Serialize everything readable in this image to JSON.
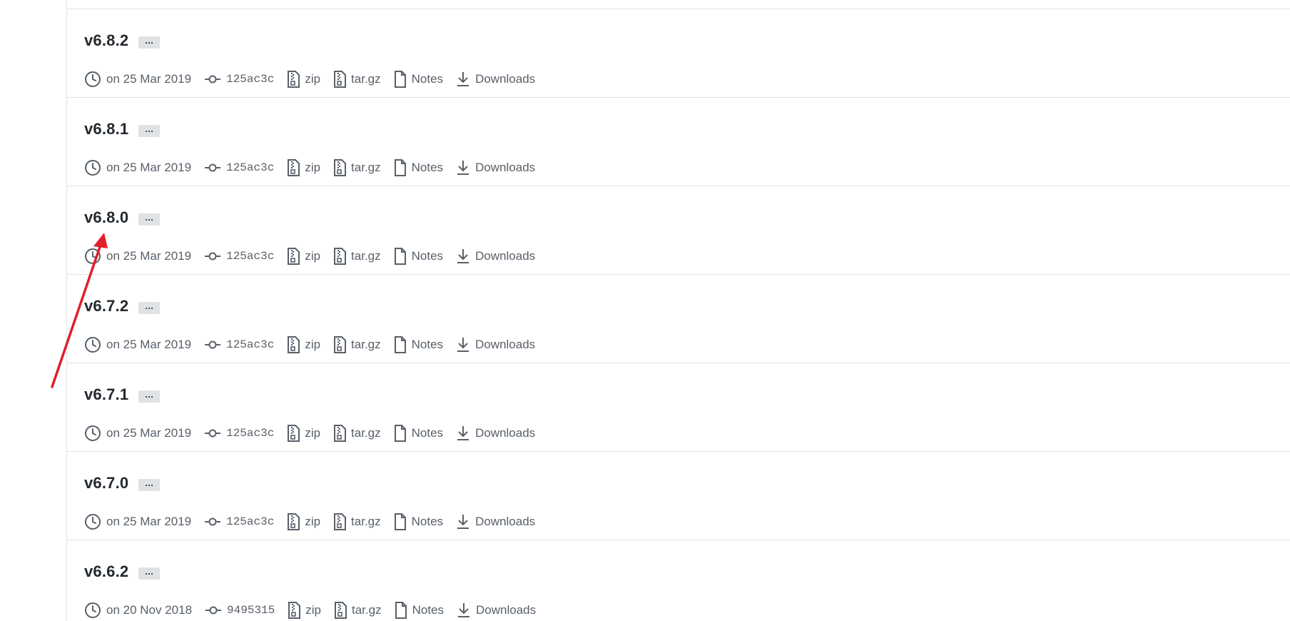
{
  "tags": [
    {
      "name": "v6.8.2",
      "date": "on 25 Mar 2019",
      "commit": "125ac3c",
      "zip": "zip",
      "targz": "tar.gz",
      "notes": "Notes",
      "downloads": "Downloads"
    },
    {
      "name": "v6.8.1",
      "date": "on 25 Mar 2019",
      "commit": "125ac3c",
      "zip": "zip",
      "targz": "tar.gz",
      "notes": "Notes",
      "downloads": "Downloads"
    },
    {
      "name": "v6.8.0",
      "date": "on 25 Mar 2019",
      "commit": "125ac3c",
      "zip": "zip",
      "targz": "tar.gz",
      "notes": "Notes",
      "downloads": "Downloads"
    },
    {
      "name": "v6.7.2",
      "date": "on 25 Mar 2019",
      "commit": "125ac3c",
      "zip": "zip",
      "targz": "tar.gz",
      "notes": "Notes",
      "downloads": "Downloads"
    },
    {
      "name": "v6.7.1",
      "date": "on 25 Mar 2019",
      "commit": "125ac3c",
      "zip": "zip",
      "targz": "tar.gz",
      "notes": "Notes",
      "downloads": "Downloads"
    },
    {
      "name": "v6.7.0",
      "date": "on 25 Mar 2019",
      "commit": "125ac3c",
      "zip": "zip",
      "targz": "tar.gz",
      "notes": "Notes",
      "downloads": "Downloads"
    },
    {
      "name": "v6.6.2",
      "date": "on 20 Nov 2018",
      "commit": "9495315",
      "zip": "zip",
      "targz": "tar.gz",
      "notes": "Notes",
      "downloads": "Downloads"
    }
  ],
  "icons": {
    "date": "clock-icon",
    "commit": "git-commit-icon",
    "zip": "file-zip-icon",
    "targz": "file-zip-icon",
    "notes": "file-icon",
    "downloads": "download-icon"
  },
  "colors": {
    "annotation_arrow": "#e0202a",
    "border": "#e1e4e8",
    "meta_text": "#586069",
    "title_text": "#24292e"
  }
}
